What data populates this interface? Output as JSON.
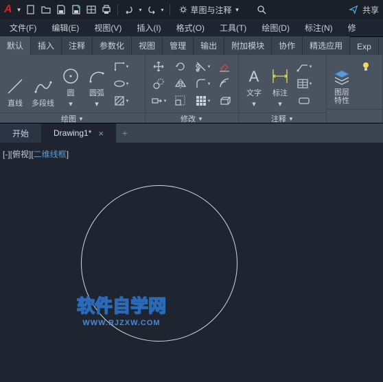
{
  "titlebar": {
    "workspace": "草图与注释",
    "share": "共享"
  },
  "menubar": {
    "file": "文件(F)",
    "edit": "编辑(E)",
    "view": "视图(V)",
    "insert": "插入(I)",
    "format": "格式(O)",
    "tools": "工具(T)",
    "draw": "绘图(D)",
    "dimension": "标注(N)",
    "modify": "修"
  },
  "ribbonTabs": {
    "default": "默认",
    "insert": "插入",
    "annotate": "注释",
    "parametric": "参数化",
    "view": "视图",
    "manage": "管理",
    "output": "输出",
    "addins": "附加模块",
    "collab": "协作",
    "featured": "精选应用",
    "exp": "Exp"
  },
  "panels": {
    "draw": {
      "label": "绘图",
      "line": "直线",
      "polyline": "多段线",
      "circle": "圆",
      "arc": "圆弧"
    },
    "modify": {
      "label": "修改"
    },
    "annotate": {
      "label": "注释",
      "text": "文字",
      "dim": "标注"
    },
    "layers": {
      "label": "图层\n特性"
    }
  },
  "fileTabs": {
    "start": "开始",
    "drawing": "Drawing1*"
  },
  "viewport": {
    "part1": "[-][俯视][",
    "part2": "二维线框",
    "part3": "]"
  },
  "watermark": {
    "main": "软件自学网",
    "sub": "WWW.RJZXW.COM"
  }
}
